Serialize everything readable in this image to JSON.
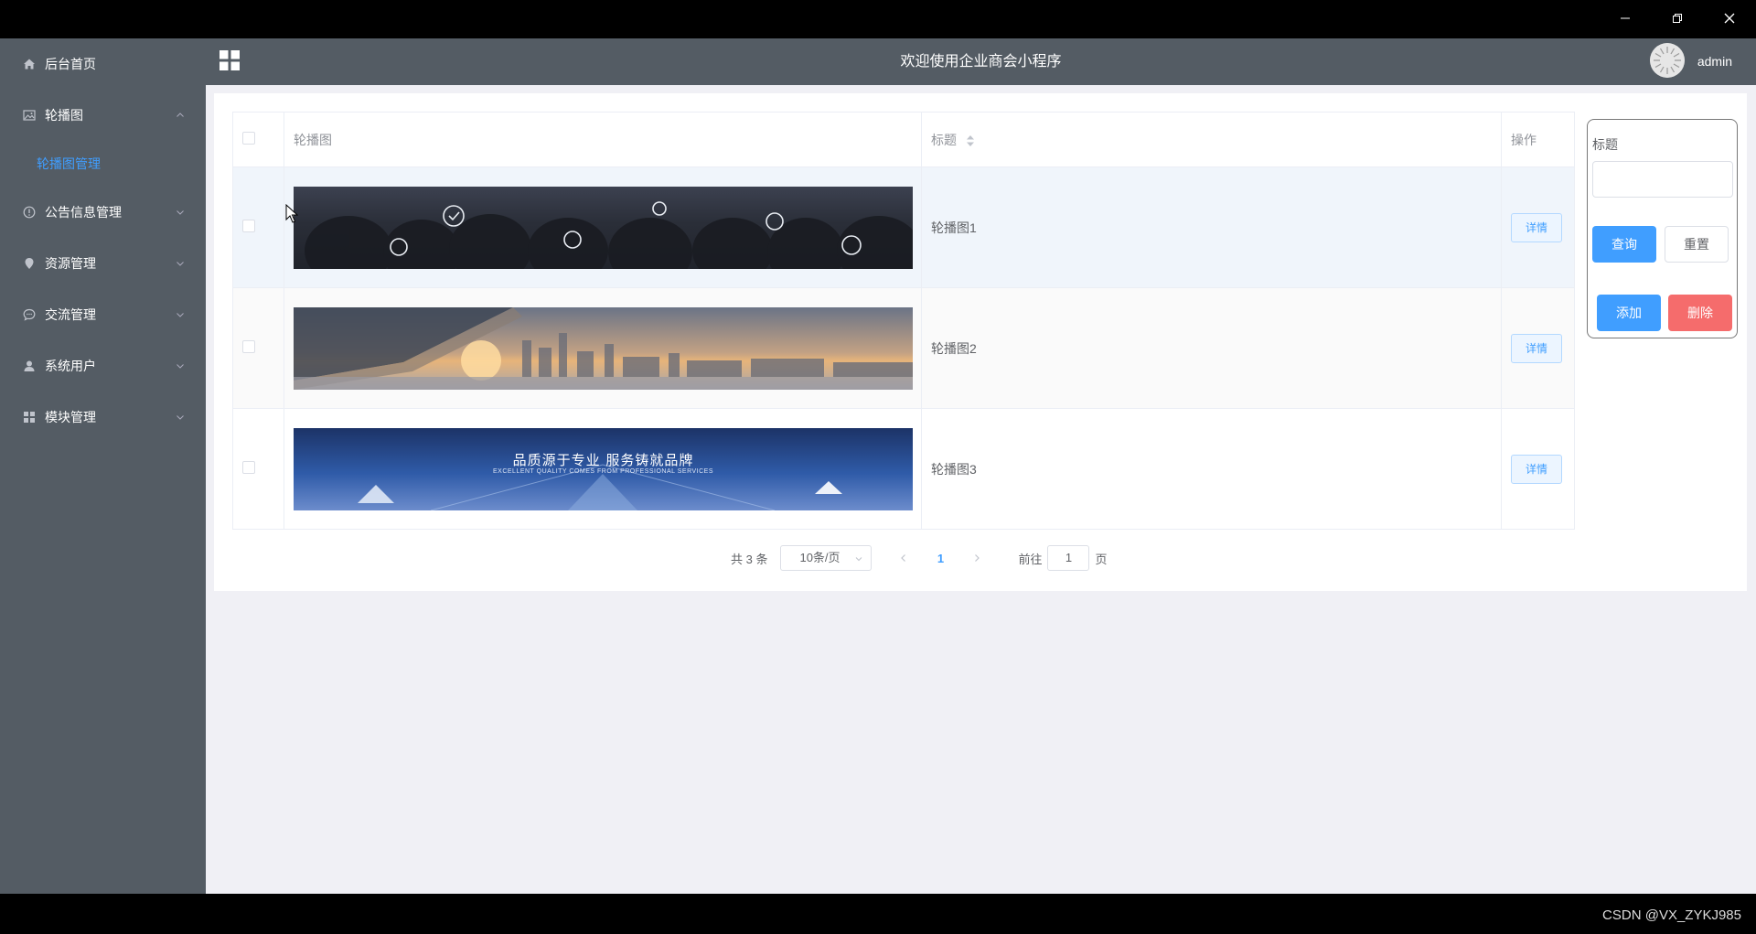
{
  "window": {
    "minimize_icon": "minimize-icon",
    "restore_icon": "restore-icon",
    "close_icon": "close-icon"
  },
  "sidebar": {
    "items": [
      {
        "label": "后台首页",
        "icon": "home-icon"
      },
      {
        "label": "轮播图",
        "icon": "image-icon",
        "expanded": true
      },
      {
        "label": "公告信息管理",
        "icon": "info-icon"
      },
      {
        "label": "资源管理",
        "icon": "location-icon"
      },
      {
        "label": "交流管理",
        "icon": "chat-icon"
      },
      {
        "label": "系统用户",
        "icon": "user-icon"
      },
      {
        "label": "模块管理",
        "icon": "grid-icon"
      }
    ],
    "submenu": {
      "label": "轮播图管理"
    }
  },
  "header": {
    "title": "欢迎使用企业商会小程序",
    "username": "admin"
  },
  "table": {
    "columns": {
      "image": "轮播图",
      "title": "标题",
      "action": "操作"
    },
    "rows": [
      {
        "title": "轮播图1",
        "action": "详情"
      },
      {
        "title": "轮播图2",
        "action": "详情"
      },
      {
        "title": "轮播图3",
        "action": "详情",
        "banner_text": "品质源于专业 服务铸就品牌",
        "banner_subtext": "EXCELLENT QUALITY COMES FROM PROFESSIONAL SERVICES"
      }
    ]
  },
  "pagination": {
    "total": "共 3 条",
    "page_size": "10条/页",
    "current_page": "1",
    "goto_prefix": "前往",
    "goto_value": "1",
    "goto_suffix": "页"
  },
  "search": {
    "label": "标题",
    "query": "查询",
    "reset": "重置",
    "add": "添加",
    "delete": "删除"
  },
  "footer": {
    "watermark": "CSDN @VX_ZYKJ985"
  },
  "colors": {
    "primary": "#409eff",
    "danger": "#f56c6c",
    "sidebar": "#545c64"
  }
}
